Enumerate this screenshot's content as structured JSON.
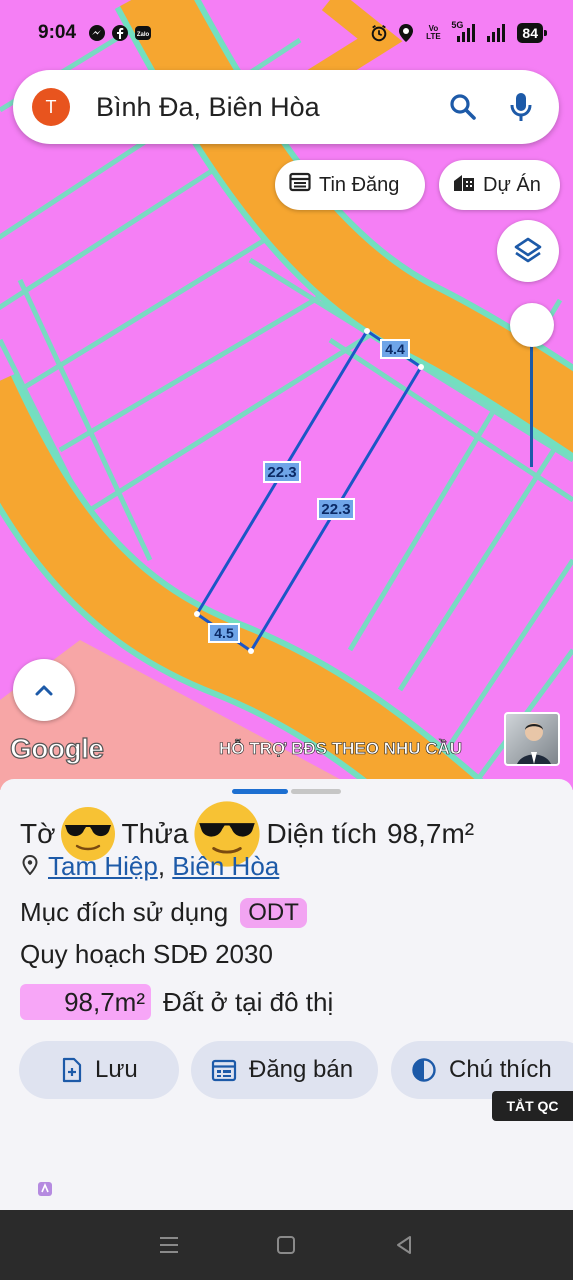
{
  "status_bar": {
    "time": "9:04",
    "battery": "84",
    "network_5g": "5G",
    "volte_label": "Vo LTE",
    "left_icons": [
      "messenger-icon",
      "facebook-icon",
      "zalo-icon"
    ],
    "right_icons": [
      "alarm-icon",
      "location-icon",
      "volte-icon",
      "signal-icon",
      "signal-icon",
      "battery-icon"
    ]
  },
  "search": {
    "avatar_letter": "T",
    "query": "Bình Đa, Biên Hòa"
  },
  "chips": {
    "tin_dang": "Tin Đăng",
    "du_an": "Dự Án"
  },
  "map": {
    "dimensions": {
      "top": "4.4",
      "left": "22.3",
      "right": "22.3",
      "bottom": "4.5"
    },
    "attribution": "Google",
    "ad_text": "HỖ TRỢ BĐS  THEO NHU CẦU",
    "colors": {
      "land": "#f57ff5",
      "road": "#f6a630",
      "parcel_line": "#73dfc0",
      "plot_outline": "#1b56c6",
      "salmon": "#f7a6a6"
    }
  },
  "sheet": {
    "to_label": "Tờ",
    "thua_label": "Thửa",
    "dien_tich_label": "Diện tích",
    "dien_tich_value": "98,7m²",
    "location_ward": "Tam Hiệp",
    "location_sep": ",",
    "location_city": "Biên Hòa",
    "purpose_label": "Mục đích sử dụng",
    "purpose_code": "ODT",
    "planning_label": "Quy hoạch SDĐ 2030",
    "planning_area": "98,7m²",
    "planning_desc": "Đất ở tại đô thị",
    "buttons": {
      "luu": "Lưu",
      "dang_ban": "Đăng bán",
      "chu_thich": "Chú thích"
    },
    "ad_close": "TẮT QC"
  }
}
